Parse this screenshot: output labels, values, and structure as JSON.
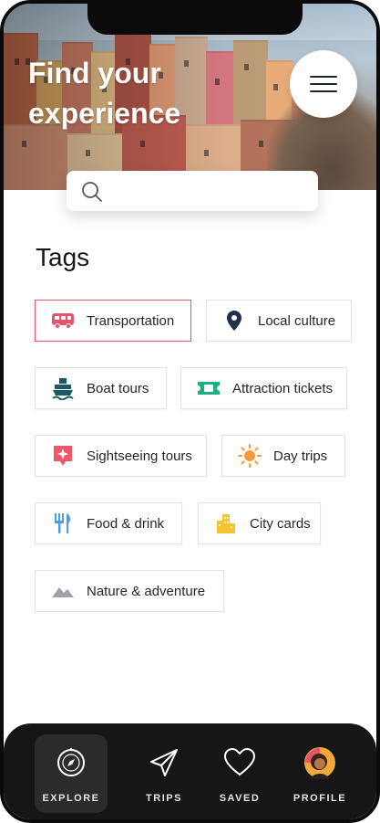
{
  "hero": {
    "title": "Find your experience"
  },
  "search": {
    "placeholder": "",
    "value": ""
  },
  "tags": {
    "title": "Tags",
    "items": [
      {
        "label": "Transportation",
        "icon": "bus-icon",
        "color": "#e4556a",
        "active": true
      },
      {
        "label": "Local culture",
        "icon": "location-pin-icon",
        "color": "#22304a",
        "active": false
      },
      {
        "label": "Boat tours",
        "icon": "ship-icon",
        "color": "#1c5a63",
        "active": false
      },
      {
        "label": "Attraction tickets",
        "icon": "ticket-icon",
        "color": "#1bb080",
        "active": false
      },
      {
        "label": "Sightseeing tours",
        "icon": "sparkle-pin-icon",
        "color": "#f0566e",
        "active": false
      },
      {
        "label": "Day trips",
        "icon": "sun-icon",
        "color": "#f59a3a",
        "active": false
      },
      {
        "label": "Food & drink",
        "icon": "fork-knife-icon",
        "color": "#4a9de8",
        "active": false
      },
      {
        "label": "City cards",
        "icon": "city-buildings-icon",
        "color": "#f4c531",
        "active": false
      },
      {
        "label": "Nature & adventure",
        "icon": "mountain-icon",
        "color": "#a0a4aa",
        "active": false
      }
    ]
  },
  "nav": {
    "items": [
      {
        "label": "EXPLORE",
        "icon": "compass-icon",
        "active": true
      },
      {
        "label": "TRIPS",
        "icon": "paper-plane-icon",
        "active": false
      },
      {
        "label": "SAVED",
        "icon": "heart-icon",
        "active": false
      },
      {
        "label": "PROFILE",
        "icon": "avatar",
        "active": false
      }
    ]
  }
}
